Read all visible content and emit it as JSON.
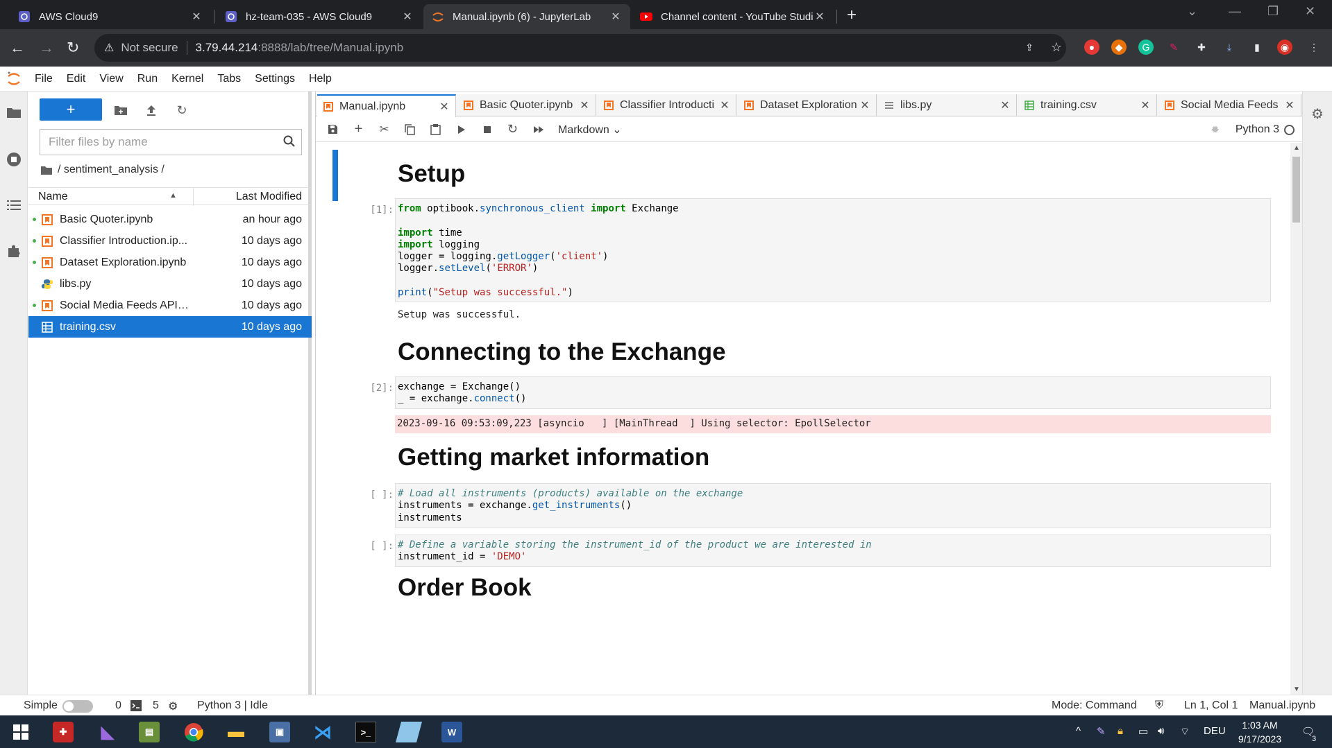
{
  "browser": {
    "tabs": [
      {
        "title": "AWS Cloud9"
      },
      {
        "title": "hz-team-035 - AWS Cloud9"
      },
      {
        "title": "Manual.ipynb (6) - JupyterLab"
      },
      {
        "title": "Channel content - YouTube Studio"
      }
    ],
    "address": {
      "security_label": "Not secure",
      "host": "3.79.44.214",
      "path": ":8888/lab/tree/Manual.ipynb"
    }
  },
  "menu": [
    "File",
    "Edit",
    "View",
    "Run",
    "Kernel",
    "Tabs",
    "Settings",
    "Help"
  ],
  "filebrowser": {
    "filter_placeholder": "Filter files by name",
    "breadcrumb": "/ sentiment_analysis /",
    "col_name": "Name",
    "col_modified": "Last Modified",
    "files": [
      {
        "name": "Basic Quoter.ipynb",
        "modified": "an hour ago",
        "type": "notebook",
        "running": true
      },
      {
        "name": "Classifier Introduction.ip...",
        "modified": "10 days ago",
        "type": "notebook",
        "running": true
      },
      {
        "name": "Dataset Exploration.ipynb",
        "modified": "10 days ago",
        "type": "notebook",
        "running": true
      },
      {
        "name": "libs.py",
        "modified": "10 days ago",
        "type": "python",
        "running": false
      },
      {
        "name": "Social Media Feeds API.i...",
        "modified": "10 days ago",
        "type": "notebook",
        "running": true
      },
      {
        "name": "training.csv",
        "modified": "10 days ago",
        "type": "csv",
        "running": false,
        "selected": true
      }
    ]
  },
  "doc_tabs": [
    {
      "title": "Manual.ipynb",
      "type": "notebook",
      "active": true
    },
    {
      "title": "Basic Quoter.ipynb",
      "type": "notebook"
    },
    {
      "title": "Classifier Introducti",
      "type": "notebook"
    },
    {
      "title": "Dataset Exploration",
      "type": "notebook"
    },
    {
      "title": "libs.py",
      "type": "text"
    },
    {
      "title": "training.csv",
      "type": "csv"
    },
    {
      "title": "Social Media Feeds",
      "type": "notebook"
    }
  ],
  "notebook": {
    "cell_type": "Markdown",
    "kernel": "Python 3",
    "headings": {
      "setup": "Setup",
      "connecting": "Connecting to the Exchange",
      "market": "Getting market information",
      "orderbook": "Order Book"
    },
    "cells": {
      "c1_prompt": "[1]:",
      "c1_output": "Setup was successful.",
      "c2_prompt": "[2]:",
      "c2_stderr": "2023-09-16 09:53:09,223 [asyncio   ] [MainThread  ] Using selector: EpollSelector",
      "c3_prompt": "[ ]:",
      "c4_prompt": "[ ]:"
    }
  },
  "statusbar": {
    "mode_label": "Simple",
    "terminals": "0",
    "kernels": "5",
    "kernel_status": "Python 3 | Idle",
    "mode": "Mode: Command",
    "cursor": "Ln 1, Col 1",
    "file": "Manual.ipynb"
  },
  "taskbar": {
    "lang": "DEU",
    "time": "1:03 AM",
    "date": "9/17/2023",
    "notifications": "3"
  },
  "colors": {
    "accent": "#1976d2",
    "chrome_dark": "#202124",
    "stderr_bg": "#fddede"
  }
}
